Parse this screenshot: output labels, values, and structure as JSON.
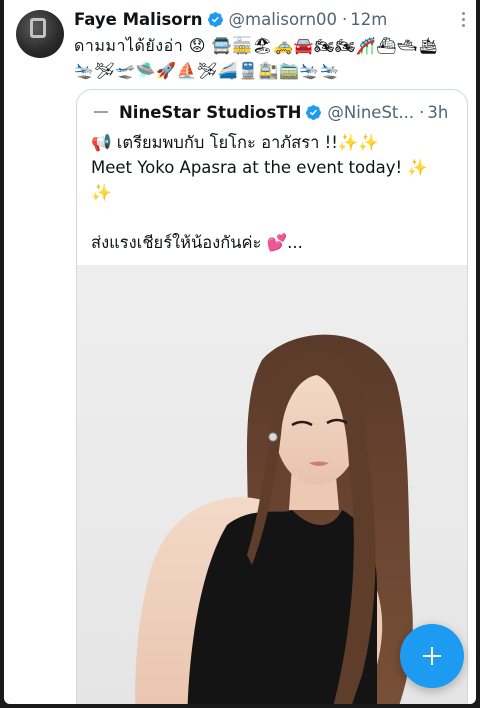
{
  "tweet": {
    "author_name": "Faye Malisorn",
    "handle": "@malisorn00",
    "separator": "·",
    "time": "12m",
    "text_line1": "ดามมาได้ยังอ่า 😟 🚍🚋🏖🚕🚘🏍🏍🎢⛴🛥🛳",
    "text_line2": "🛬🛩🛫🛸🚀⛵🛩🚄🚆🚉🚞🛬🛬"
  },
  "quoted_tweet": {
    "author_name": "NineStar StudiosTH",
    "handle": "@NineSt...",
    "separator": "·",
    "time": "3h",
    "text_lines": [
      "📢 เตรียมพบกับ โยโกะ อาภัสรา !!✨✨",
      "Meet Yoko Apasra at the event today! ✨",
      "✨",
      "",
      "ส่งแรงเชียร์ให้น้องกันค่ะ 💕..."
    ]
  },
  "colors": {
    "accent": "#1d9bf0",
    "text": "#0f1419",
    "secondary_text": "#536471",
    "border": "#cfd9de"
  },
  "icons": {
    "verified": "verified-badge-icon",
    "more": "more-vertical-icon",
    "compose": "plus-icon"
  }
}
